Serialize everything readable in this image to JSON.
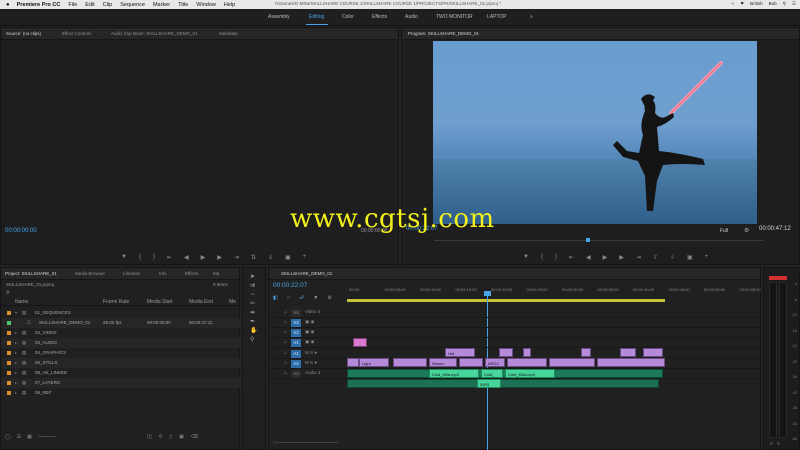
{
  "menubar": {
    "apple": "",
    "app": "Premiere Pro CC",
    "items": [
      "File",
      "Edit",
      "Clip",
      "Sequence",
      "Marker",
      "Title",
      "Window",
      "Help"
    ],
    "path": "/Volumes/G-MINI/SKILLSHARE COURSE 1/SKILLSHARE COURSE 1/PROJECTS/PR/SKILLSHARE_01.prproj *",
    "right": [
      "British",
      "Bob"
    ]
  },
  "workspaces": {
    "items": [
      "Assembly",
      "Editing",
      "Color",
      "Effects",
      "Audio",
      "TWO MONITOR",
      "LAPTOP"
    ],
    "active": "Editing",
    "overflow": "»"
  },
  "source": {
    "tabs": [
      "Source: (no clips)",
      "Effect Controls",
      "Audio Clip Mixer: SKILLSHARE_DEMO_01",
      "Metadata"
    ],
    "timecode": "00;00;00;00",
    "right_timecode": "00;00;00;00"
  },
  "program": {
    "tab": "Program: SKILLSHARE_DEMO_01",
    "timecode": "00:00:22:07",
    "fit": "Full",
    "duration": "00:00:47:12",
    "watermark": "www.cgtsj.com"
  },
  "project": {
    "tabs": [
      "Project: SKILLSHARE_01",
      "Media Browser",
      "Libraries",
      "Info",
      "Effects",
      "Ma"
    ],
    "file": "SKILLSHARE_01.prproj",
    "items_count": "9 Items",
    "columns": [
      "Name",
      "Frame Rate",
      "Media Start",
      "Media End",
      "Me"
    ],
    "rows": [
      {
        "name": "01_SEQUENCES",
        "color": "#e08e2a",
        "open": true
      },
      {
        "name": "SKILLSHARE_DEMO_01",
        "color": "#4fc46a",
        "fps": "25.00 fps",
        "start": "00:00:00:00",
        "end": "00:00:47:11",
        "child": true
      },
      {
        "name": "02_VIDEO",
        "color": "#e08e2a"
      },
      {
        "name": "03_AUDIO",
        "color": "#e08e2a"
      },
      {
        "name": "04_GRAPHICS",
        "color": "#e08e2a"
      },
      {
        "name": "05_STILLS",
        "color": "#e08e2a"
      },
      {
        "name": "06_AE_LINKED",
        "color": "#e08e2a"
      },
      {
        "name": "07_LAYERS",
        "color": "#e08e2a"
      },
      {
        "name": "08_REF",
        "color": "#e08e2a"
      }
    ]
  },
  "timeline": {
    "tab": "SKILLSHARE_DEMO_01",
    "timecode": "00:00:22:07",
    "ruler": [
      "00:00",
      "00:00:05:00",
      "00:00:10:00",
      "00:00:15:00",
      "00:00:20:00",
      "00:00:25:00",
      "00:00:30:00",
      "00:00:35:00",
      "00:00:40:00",
      "00:00:45:00",
      "00:00:50:00",
      "00:00:55:00",
      "00:01:00:00"
    ],
    "tracks": [
      {
        "id": "V4",
        "name": "Video 4",
        "active": false
      },
      {
        "id": "V3",
        "name": "",
        "active": true
      },
      {
        "id": "V2",
        "name": "",
        "active": true
      },
      {
        "id": "V1",
        "name": "",
        "active": true
      },
      {
        "id": "A1",
        "name": "",
        "active": true
      },
      {
        "id": "A2",
        "name": "",
        "active": true
      },
      {
        "id": "A3",
        "name": "Audio 3",
        "active": false
      }
    ],
    "clip_labels": {
      "v1a": "Light",
      "v1b": "Desert",
      "v1c": "ARG2",
      "v2a": "Hot",
      "a1a": "Cold_Killa.mp3",
      "a1b": "Cold_",
      "a1c": "Cold_Killa.mp3",
      "a2a": "2693"
    }
  },
  "meter": {
    "scale": [
      "0",
      "-6",
      "-12",
      "-18",
      "-24",
      "-30",
      "-36",
      "-42",
      "-48",
      "-54",
      "dB"
    ]
  },
  "colors": {
    "accent": "#49a5ea",
    "track_blue": "#2e6ea8",
    "video_clip": "#b48ad9",
    "audio_clip": "#1c7a5b",
    "audio_clip_light": "#47d59a",
    "folder": "#e08e2a",
    "meter_red": "#d0302f"
  }
}
